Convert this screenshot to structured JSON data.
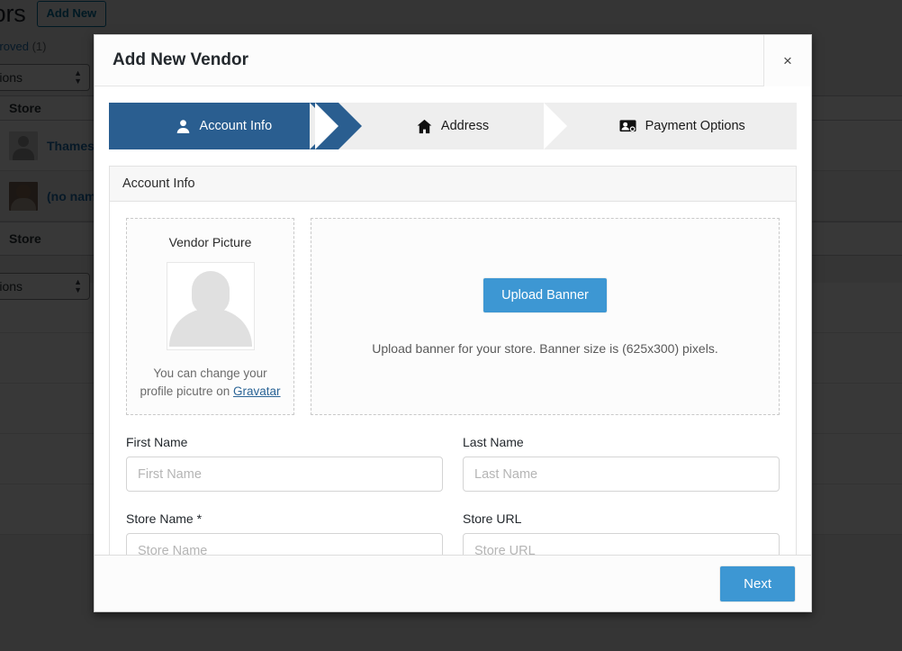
{
  "background": {
    "page_title": "ndors",
    "add_new_label": "Add New",
    "subsubsub": {
      "separator": "|",
      "approved_label": "Approved",
      "approved_count": "(1)"
    },
    "bulk_actions_label": "k Actions",
    "column_store": "Store",
    "rows": [
      {
        "name": "Thames I",
        "avatar": "gray-avatar"
      },
      {
        "name": "(no name",
        "avatar": "photo-avatar"
      }
    ],
    "footer_column_store": "Store",
    "bulk_actions_bottom_label": "k Actions"
  },
  "modal": {
    "title": "Add New Vendor",
    "close_label": "×",
    "steps": [
      {
        "label": "Account Info",
        "icon": "user-icon",
        "active": true
      },
      {
        "label": "Address",
        "icon": "home-icon",
        "active": false
      },
      {
        "label": "Payment Options",
        "icon": "payment-card-icon",
        "active": false
      }
    ],
    "panel": {
      "heading": "Account Info",
      "picture": {
        "title": "Vendor Picture",
        "note_line1": "You can change your",
        "note_line2_prefix": "profile picutre on ",
        "gravatar_link": "Gravatar",
        "avatar_icon": "user-placeholder-avatar"
      },
      "banner": {
        "upload_button": "Upload Banner",
        "note": "Upload banner for your store. Banner size is (625x300) pixels."
      },
      "fields": [
        {
          "label": "First Name",
          "placeholder": "First Name",
          "value": ""
        },
        {
          "label": "Last Name",
          "placeholder": "Last Name",
          "value": ""
        },
        {
          "label": "Store Name *",
          "placeholder": "Store Name",
          "value": ""
        },
        {
          "label": "Store URL",
          "placeholder": "Store URL",
          "value": ""
        }
      ]
    },
    "footer": {
      "next_label": "Next"
    }
  },
  "colors": {
    "active_step": "#2a5e90",
    "primary_button": "#3d97d3",
    "link": "#2a6496",
    "panel_head": "#f7f7f7"
  }
}
